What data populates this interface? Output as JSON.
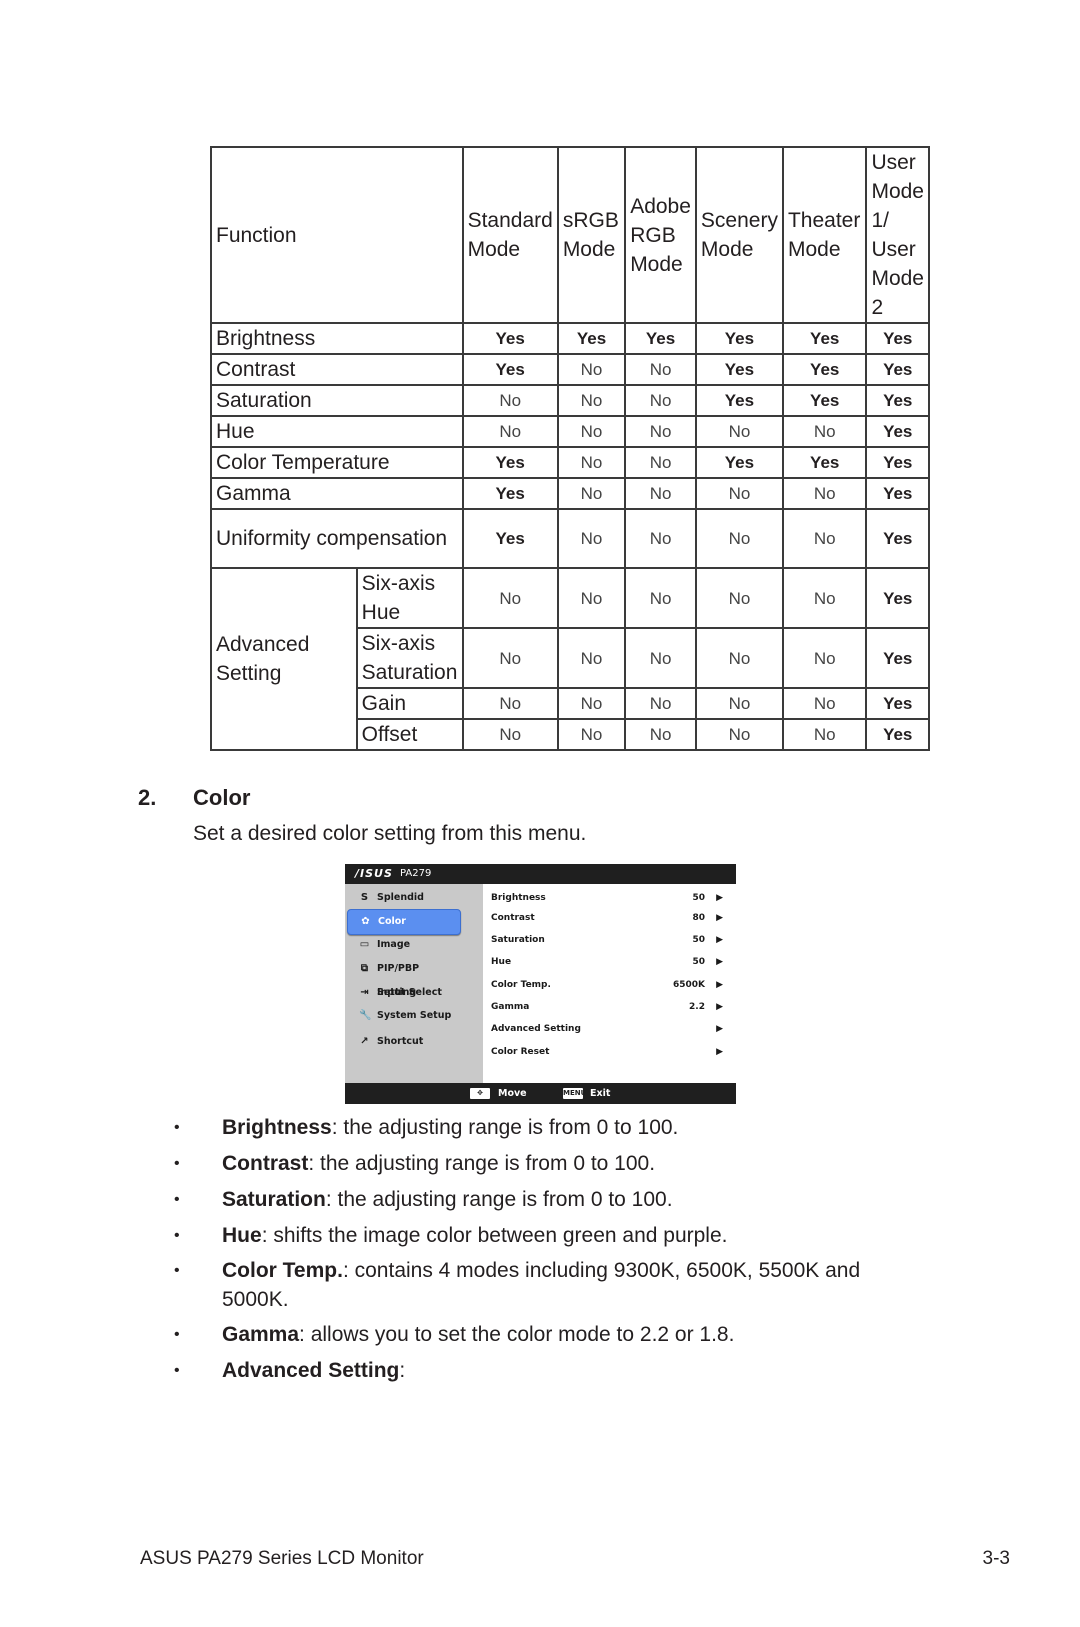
{
  "table": {
    "headers": {
      "function": "Function",
      "modes": [
        "Standard Mode",
        "sRGB Mode",
        "Adobe RGB Mode",
        "Scenery Mode",
        "Theater Mode",
        "User Mode 1/ User Mode 2"
      ]
    },
    "rows": [
      {
        "function": "Brightness",
        "values": [
          "Yes",
          "Yes",
          "Yes",
          "Yes",
          "Yes",
          "Yes"
        ]
      },
      {
        "function": "Contrast",
        "values": [
          "Yes",
          "No",
          "No",
          "Yes",
          "Yes",
          "Yes"
        ]
      },
      {
        "function": "Saturation",
        "values": [
          "No",
          "No",
          "No",
          "Yes",
          "Yes",
          "Yes"
        ]
      },
      {
        "function": "Hue",
        "values": [
          "No",
          "No",
          "No",
          "No",
          "No",
          "Yes"
        ]
      },
      {
        "function": "Color Temperature",
        "values": [
          "Yes",
          "No",
          "No",
          "Yes",
          "Yes",
          "Yes"
        ]
      },
      {
        "function": "Gamma",
        "values": [
          "Yes",
          "No",
          "No",
          "No",
          "No",
          "Yes"
        ]
      },
      {
        "function": "Uniformity compensation",
        "values": [
          "Yes",
          "No",
          "No",
          "No",
          "No",
          "Yes"
        ]
      }
    ],
    "advanced": {
      "group_label": "Advanced Setting",
      "rows": [
        {
          "function": "Six-axis Hue",
          "values": [
            "No",
            "No",
            "No",
            "No",
            "No",
            "Yes"
          ]
        },
        {
          "function": "Six-axis Saturation",
          "values": [
            "No",
            "No",
            "No",
            "No",
            "No",
            "Yes"
          ]
        },
        {
          "function": "Gain",
          "values": [
            "No",
            "No",
            "No",
            "No",
            "No",
            "Yes"
          ]
        },
        {
          "function": "Offset",
          "values": [
            "No",
            "No",
            "No",
            "No",
            "No",
            "Yes"
          ]
        }
      ]
    }
  },
  "section": {
    "number": "2.",
    "title": "Color",
    "description": "Set a desired color setting from this menu."
  },
  "osd": {
    "brand": "/ISUS",
    "model": "PA279",
    "accent_color": "#5b8ff0",
    "menu": [
      {
        "label": "Splendid",
        "icon": "splendid-icon",
        "glyph": "S",
        "selected": false
      },
      {
        "label": "Color",
        "icon": "palette-icon",
        "glyph": "✿",
        "selected": true
      },
      {
        "label": "Image",
        "icon": "image-icon",
        "glyph": "▭",
        "selected": false
      },
      {
        "label": "PIP/PBP Setting",
        "icon": "pip-icon",
        "glyph": "⧉",
        "selected": false
      },
      {
        "label": "Input Select",
        "icon": "input-icon",
        "glyph": "⇥",
        "selected": false
      },
      {
        "label": "System Setup",
        "icon": "wrench-icon",
        "glyph": "🔧",
        "selected": false
      },
      {
        "label": "Shortcut",
        "icon": "shortcut-icon",
        "glyph": "↗",
        "selected": false
      }
    ],
    "settings": [
      {
        "label": "Brightness",
        "value": "50",
        "arrow": "▶"
      },
      {
        "label": "Contrast",
        "value": "80",
        "arrow": "▶"
      },
      {
        "label": "Saturation",
        "value": "50",
        "arrow": "▶"
      },
      {
        "label": "Hue",
        "value": "50",
        "arrow": "▶"
      },
      {
        "label": "Color Temp.",
        "value": "6500K",
        "arrow": "▶"
      },
      {
        "label": "Gamma",
        "value": "2.2",
        "arrow": "▶"
      },
      {
        "label": "Advanced Setting",
        "value": "",
        "arrow": "▶"
      },
      {
        "label": "Color Reset",
        "value": "",
        "arrow": "▶"
      }
    ],
    "footer": {
      "move_key": "✥",
      "move_label": "Move",
      "exit_key": "MENU",
      "exit_label": "Exit"
    }
  },
  "bullets": [
    {
      "term": "Brightness",
      "text": ": the adjusting range is from 0 to 100."
    },
    {
      "term": "Contrast",
      "text": ": the adjusting range is from 0 to 100."
    },
    {
      "term": "Saturation",
      "text": ": the adjusting range is from 0 to 100."
    },
    {
      "term": "Hue",
      "text": ": shifts the image color between green and purple."
    },
    {
      "term": "Color Temp.",
      "text": ": contains 4 modes including 9300K, 6500K, 5500K and 5000K."
    },
    {
      "term": "Gamma",
      "text": ": allows you to set the color mode to 2.2 or 1.8."
    },
    {
      "term": "Advanced Setting",
      "text": ":"
    }
  ],
  "bullet_glyph": "•",
  "footer": {
    "title": "ASUS PA279 Series LCD Monitor",
    "page": "3-3"
  }
}
